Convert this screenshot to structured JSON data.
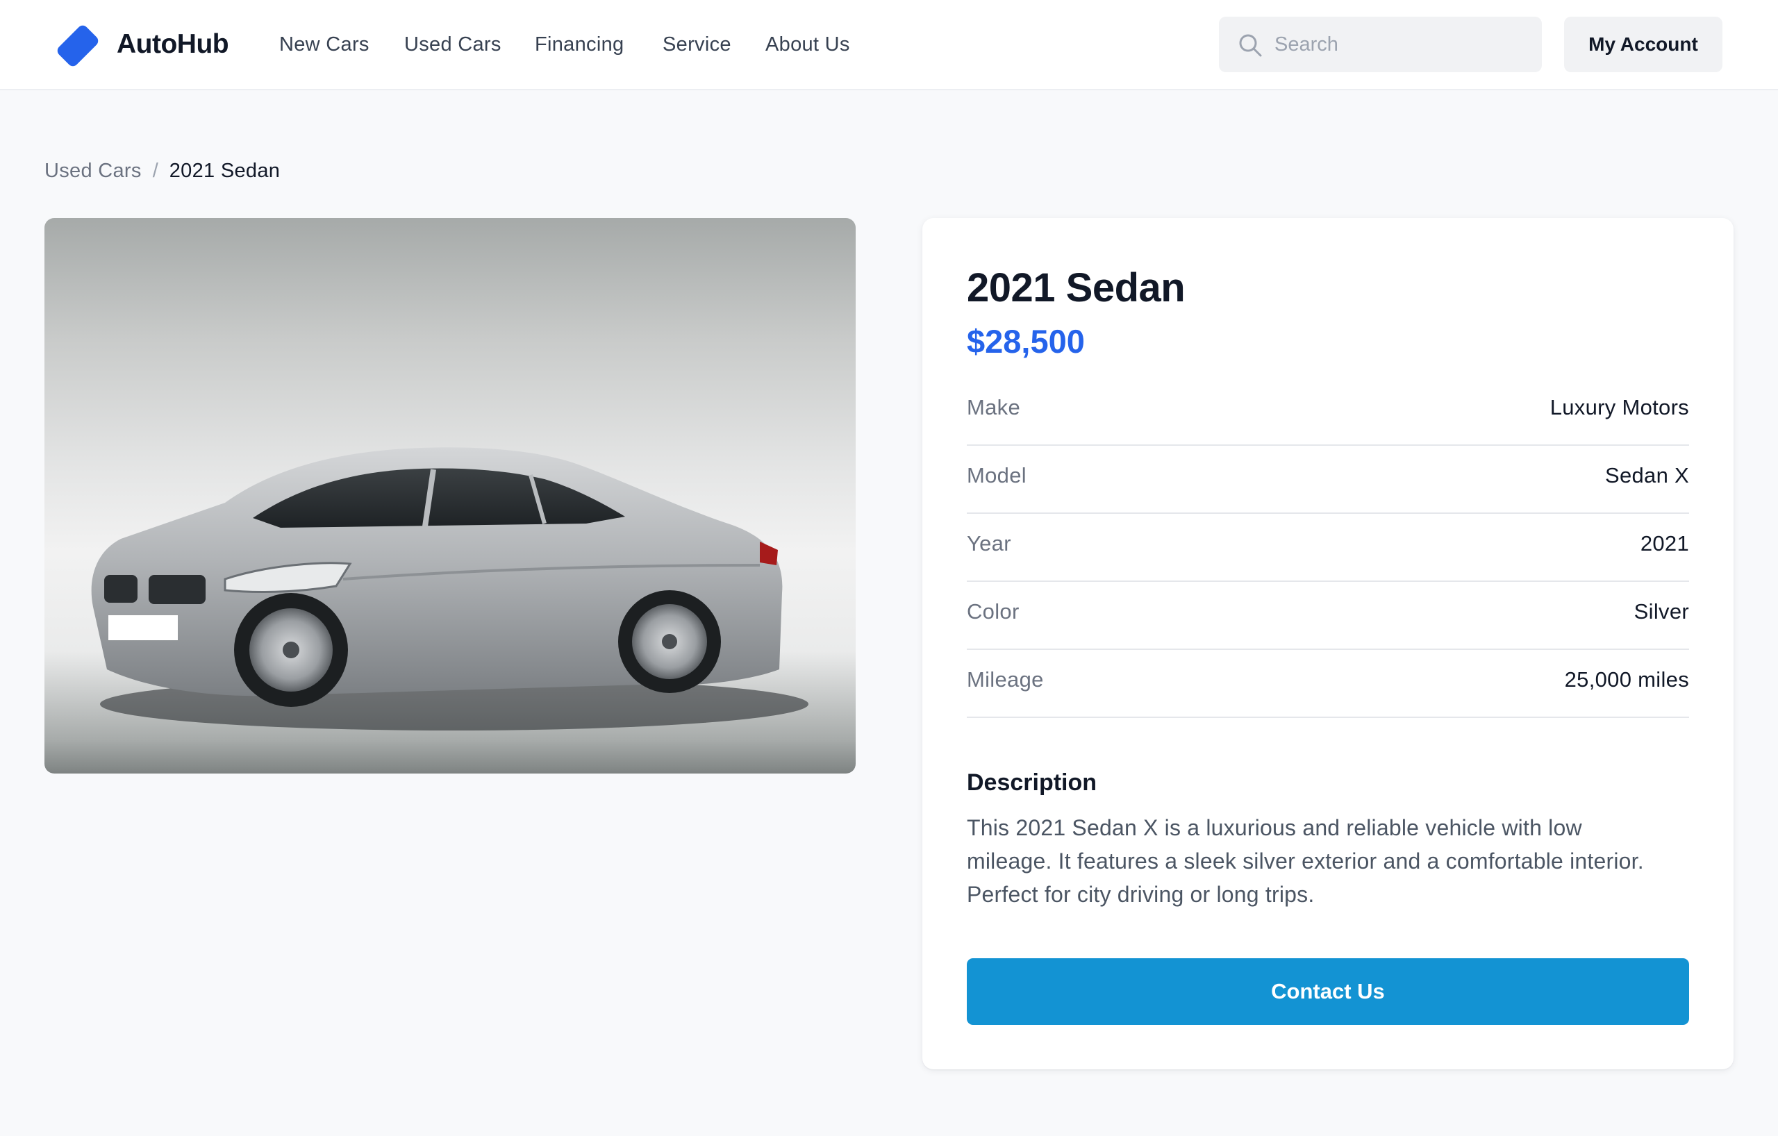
{
  "header": {
    "brand": "AutoHub",
    "nav": [
      "New Cars",
      "Used Cars",
      "Financing",
      "Service",
      "About Us"
    ],
    "search_placeholder": "Search",
    "account_label": "My Account"
  },
  "breadcrumb": {
    "parent": "Used Cars",
    "separator": "/",
    "current": "2021 Sedan"
  },
  "car": {
    "title": "2021 Sedan",
    "price": "$28,500",
    "specs": [
      {
        "label": "Make",
        "value": "Luxury Motors"
      },
      {
        "label": "Model",
        "value": "Sedan X"
      },
      {
        "label": "Year",
        "value": "2021"
      },
      {
        "label": "Color",
        "value": "Silver"
      },
      {
        "label": "Mileage",
        "value": "25,000 miles"
      }
    ],
    "description_heading": "Description",
    "description": "This 2021 Sedan X is a luxurious and reliable vehicle with low mileage. It features a sleek silver exterior and a comfortable interior. Perfect for city driving or long trips.",
    "contact_label": "Contact Us"
  },
  "icons": {
    "logo": "tag-logo-icon",
    "search": "search-icon"
  },
  "colors": {
    "accent": "#2563eb",
    "button": "#1393d3",
    "background": "#f8f9fb"
  }
}
